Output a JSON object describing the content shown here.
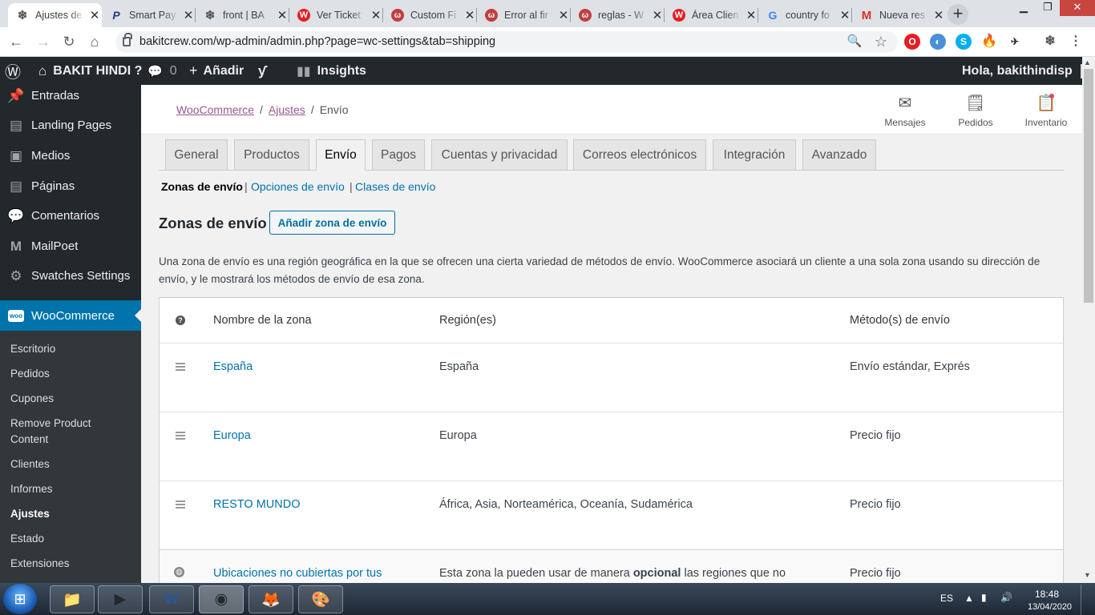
{
  "browser": {
    "tabs": [
      {
        "title": "Ajustes de",
        "icon": "snowflake-icon",
        "active": true
      },
      {
        "title": "Smart Pay",
        "icon": "paypal-icon"
      },
      {
        "title": "front | BA",
        "icon": "snowflake-icon"
      },
      {
        "title": "Ver Ticket",
        "icon": "wix-icon"
      },
      {
        "title": "Custom Fi",
        "icon": "webnode-icon"
      },
      {
        "title": "Error al fir",
        "icon": "webnode-icon"
      },
      {
        "title": "reglas - W",
        "icon": "webnode-icon"
      },
      {
        "title": "Área Clien",
        "icon": "wix-icon"
      },
      {
        "title": "country fo",
        "icon": "google-icon"
      },
      {
        "title": "Nueva res",
        "icon": "gmail-icon"
      }
    ],
    "url": "bakitcrew.com/wp-admin/admin.php?page=wc-settings&tab=shipping"
  },
  "adminbar": {
    "site_name": "BAKIT HINDI ?",
    "comments": "0",
    "add_new": "Añadir",
    "insights": "Insights",
    "greeting": "Hola, bakithindisp"
  },
  "sidebar": {
    "items": [
      "Entradas",
      "Landing Pages",
      "Medios",
      "Páginas",
      "Comentarios",
      "MailPoet",
      "Swatches Settings"
    ],
    "woocommerce": "WooCommerce",
    "submenu": [
      "Escritorio",
      "Pedidos",
      "Cupones",
      "Remove Product Content",
      "Clientes",
      "Informes",
      "Ajustes",
      "Estado",
      "Extensiones"
    ]
  },
  "header": {
    "breadcrumb": [
      "WooCommerce",
      "Ajustes",
      "Envío"
    ],
    "actions": [
      "Mensajes",
      "Pedidos",
      "Inventario"
    ]
  },
  "settings_tabs": [
    "General",
    "Productos",
    "Envío",
    "Pagos",
    "Cuentas y privacidad",
    "Correos electrónicos",
    "Integración",
    "Avanzado"
  ],
  "subsections": [
    "Zonas de envío",
    "Opciones de envío",
    "Clases de envío"
  ],
  "page": {
    "heading": "Zonas de envío",
    "add_button": "Añadir zona de envío",
    "description": "Una zona de envío es una región geográfica en la que se ofrecen una cierta variedad de métodos de envío. WooCommerce asociará un cliente a una sola zona usando su dirección de envío, y le mostrará los métodos de envío de esa zona."
  },
  "table": {
    "columns": [
      "Nombre de la zona",
      "Región(es)",
      "Método(s) de envío"
    ],
    "rows": [
      {
        "name": "España",
        "regions": "España",
        "methods": "Envío estándar, Exprés"
      },
      {
        "name": "Europa",
        "regions": "Europa",
        "methods": "Precio fijo"
      },
      {
        "name": "RESTO MUNDO",
        "regions": "África, Asia, Norteamérica, Oceanía, Sudamérica",
        "methods": "Precio fijo"
      }
    ],
    "fallback": {
      "name": "Ubicaciones no cubiertas por tus",
      "regions_pre": "Esta zona la pueden usar de manera ",
      "regions_bold": "opcional",
      "regions_post": " las regiones que no",
      "methods": "Precio fijo"
    }
  },
  "taskbar": {
    "lang": "ES",
    "time": "18:48",
    "date": "13/04/2020"
  }
}
